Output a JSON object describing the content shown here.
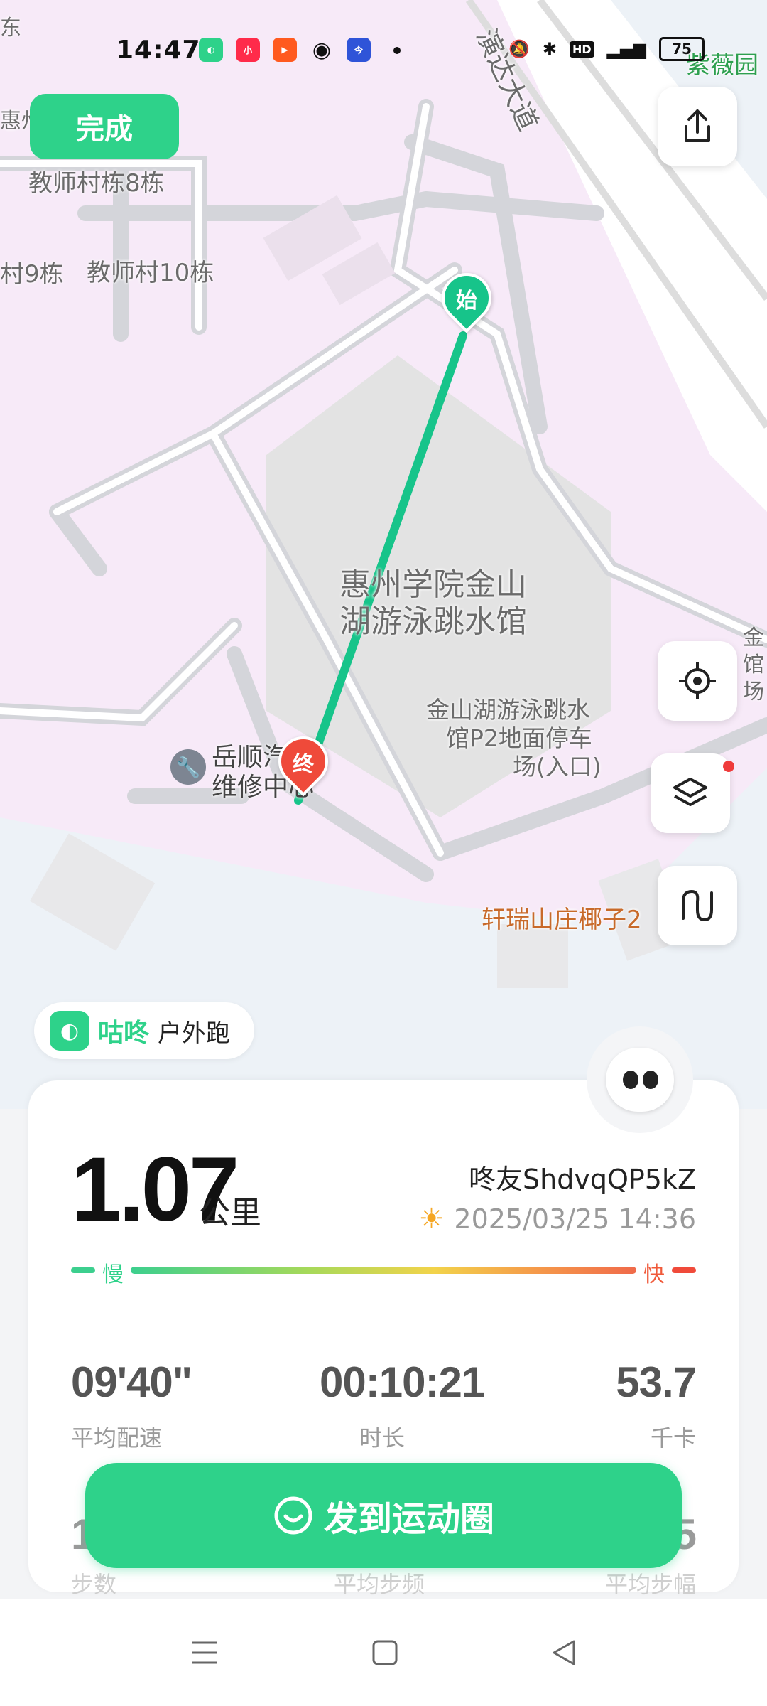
{
  "status_bar": {
    "time": "14:47",
    "battery": "75",
    "app_icons": [
      "gudong-icon",
      "xiaohongshu-icon",
      "video-icon",
      "wechat-icon",
      "school-icon"
    ],
    "indicators": [
      "mute-icon",
      "bluetooth-icon",
      "hd-icon",
      "signal-4g-icon"
    ]
  },
  "map": {
    "labels": {
      "teacher_village_8": "教师村栋8栋",
      "teacher_village_9": "村9栋",
      "teacher_village_10": "教师村10栋",
      "huizhou_partial": "惠州",
      "dong_partial": "东",
      "road_name": "演达大道",
      "venue_line1": "惠州学院金山",
      "venue_line2": "湖游泳跳水馆",
      "parking_line1": "金山湖游泳跳水",
      "parking_line2": "馆P2地面停车",
      "parking_line3": "场(入口)",
      "repair_line1": "岳顺汽",
      "repair_line2": "维修中心",
      "villa": "轩瑞山庄椰子2",
      "garden": "紫薇园",
      "right_partial_1": "金",
      "right_partial_2": "馆",
      "right_partial_3": "场"
    },
    "start_marker": "始",
    "end_marker": "终"
  },
  "buttons": {
    "done": "完成",
    "post": "发到运动圈"
  },
  "brand": {
    "name": "咕咚",
    "activity": "户外跑"
  },
  "summary": {
    "distance": "1.07",
    "distance_unit": "公里",
    "user": "咚友ShdvqQP5kZ",
    "datetime": "2025/03/25 14:36",
    "pace_slow": "慢",
    "pace_fast": "快"
  },
  "stats": [
    {
      "value": "09'40\"",
      "label": "平均配速"
    },
    {
      "value": "00:10:21",
      "label": "时长"
    },
    {
      "value": "53.7",
      "label": "千卡"
    }
  ],
  "stats_row2_partial": {
    "left_value": "1",
    "left_label": "步数",
    "center_label": "平均步频",
    "right_value": "5",
    "right_label": "平均步幅"
  },
  "colors": {
    "accent": "#2ed28a",
    "end_marker": "#ef4a3a",
    "route": "#17c48a"
  }
}
